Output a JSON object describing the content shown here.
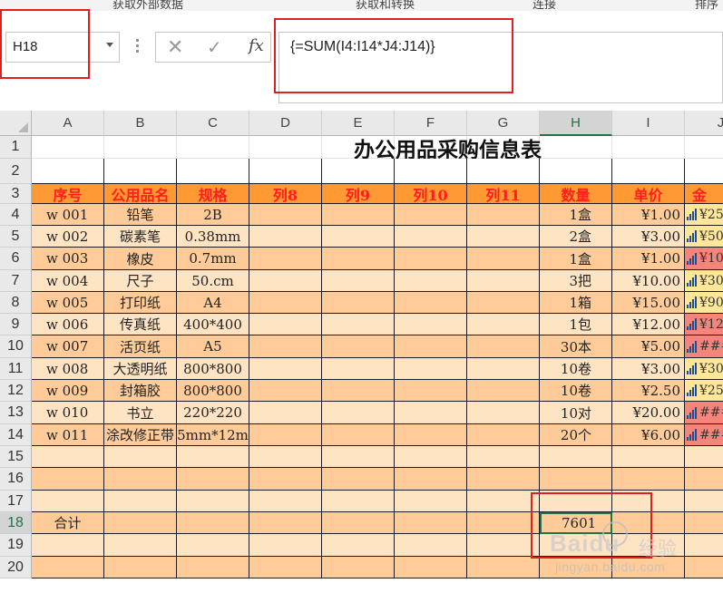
{
  "ribbon": {
    "groups": [
      "获取外部数据",
      "获取和转换",
      "连接",
      "排序"
    ]
  },
  "formula_bar": {
    "name_box": "H18",
    "cancel_icon": "close-icon",
    "enter_icon": "check-icon",
    "function_label": "fx",
    "formula": "{=SUM(I4:I14*J4:J14)}"
  },
  "columns": [
    "A",
    "B",
    "C",
    "D",
    "E",
    "F",
    "G",
    "H",
    "I",
    "J"
  ],
  "selected_column": "H",
  "rows": [
    "1",
    "2",
    "3",
    "4",
    "5",
    "6",
    "7",
    "8",
    "9",
    "10",
    "11",
    "12",
    "13",
    "14",
    "15",
    "16",
    "17",
    "18",
    "19",
    "20"
  ],
  "selected_row": "18",
  "sheet": {
    "title": "办公用品采购信息表",
    "headers": [
      "序号",
      "公用品名",
      "规格",
      "列8",
      "列9",
      "列10",
      "列11",
      "数量",
      "单价",
      "金"
    ],
    "items": [
      {
        "id": "w 001",
        "name": "铅笔",
        "spec": "2B",
        "qty": "1盒",
        "price": "¥1.00",
        "amount": "¥25"
      },
      {
        "id": "w 002",
        "name": "碳素笔",
        "spec": "0.38mm",
        "qty": "2盒",
        "price": "¥3.00",
        "amount": "¥50"
      },
      {
        "id": "w 003",
        "name": "橡皮",
        "spec": "0.7mm",
        "qty": "1盒",
        "price": "¥1.00",
        "amount": "¥10"
      },
      {
        "id": "w 004",
        "name": "尺子",
        "spec": "50.cm",
        "qty": "3把",
        "price": "¥10.00",
        "amount": "¥30"
      },
      {
        "id": "w 005",
        "name": "打印纸",
        "spec": "A4",
        "qty": "1箱",
        "price": "¥15.00",
        "amount": "¥90"
      },
      {
        "id": "w 006",
        "name": "传真纸",
        "spec": "400*400",
        "qty": "1包",
        "price": "¥12.00",
        "amount": "¥12"
      },
      {
        "id": "w 007",
        "name": "活页纸",
        "spec": "A5",
        "qty": "30本",
        "price": "¥5.00",
        "amount": "###"
      },
      {
        "id": "w 008",
        "name": "大透明纸",
        "spec": "800*800",
        "qty": "10卷",
        "price": "¥3.00",
        "amount": "¥30"
      },
      {
        "id": "w 009",
        "name": "封箱胶",
        "spec": "800*800",
        "qty": "10卷",
        "price": "¥2.50",
        "amount": "¥25"
      },
      {
        "id": "w 010",
        "name": "书立",
        "spec": "220*220",
        "qty": "10对",
        "price": "¥20.00",
        "amount": "###"
      },
      {
        "id": "w 011",
        "name": "涂改修正带",
        "spec": "5mm*12m",
        "qty": "20个",
        "price": "¥6.00",
        "amount": "###"
      }
    ],
    "total_label": "合计",
    "total_value": "7601"
  },
  "watermark": {
    "main": "Baidu",
    "cn": "经验",
    "sub": "jingyan.baidu.com"
  },
  "colors": {
    "header_fill": "#ff9933",
    "header_text": "#ff1e1e",
    "row_fill_even": "#ffcc99",
    "row_fill_odd": "#ffe4c4",
    "highlight_box": "#e02020",
    "selection": "#217346",
    "amount_high": "#f4857a",
    "amount_mid": "#ffe699"
  }
}
